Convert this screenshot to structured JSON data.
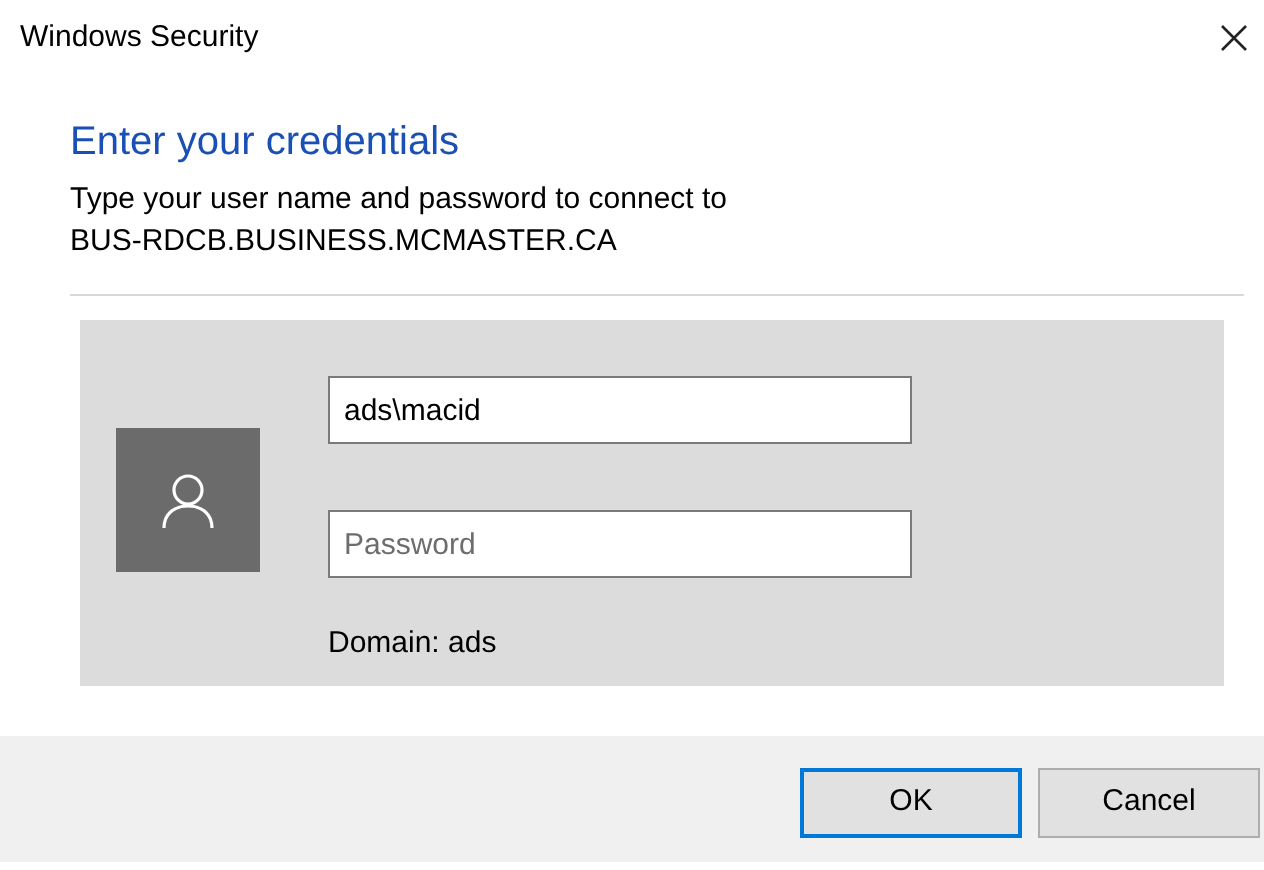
{
  "window": {
    "title": "Windows Security"
  },
  "heading": "Enter your credentials",
  "message": [
    "Type your user name and password to connect to",
    "BUS-RDCB.BUSINESS.MCMASTER.CA"
  ],
  "username": {
    "value": "ads\\macid"
  },
  "password": {
    "placeholder": "Password"
  },
  "domain": "Domain: ads",
  "buttons": [
    {
      "label": "OK",
      "focused": true
    },
    {
      "label": "Cancel",
      "focused": false
    }
  ]
}
